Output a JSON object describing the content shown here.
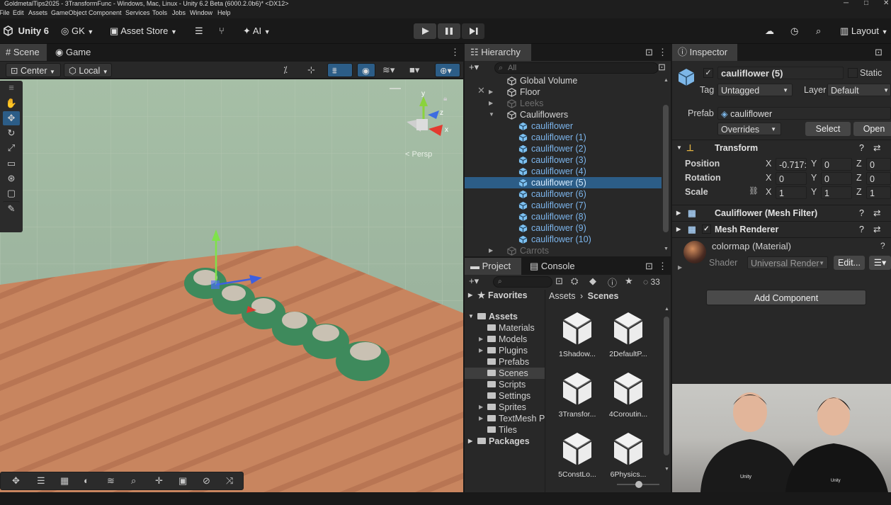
{
  "window": {
    "title": "GoldmetalTips2025 - 3TransformFunc - Windows, Mac, Linux - Unity 6.2 Beta (6000.2.0b6)* <DX12>",
    "controls": [
      "─",
      "□",
      "✕"
    ]
  },
  "menu": [
    "File",
    "Edit",
    "Assets",
    "GameObject",
    "Component",
    "Services",
    "Tools",
    "Jobs",
    "Window",
    "Help"
  ],
  "toolbar": {
    "unity_label": "Unity 6",
    "account_label": "GK",
    "asset_store_label": "Asset Store",
    "ai_label": "AI",
    "layout_label": "Layout"
  },
  "scene_panel": {
    "tabs": [
      "Scene",
      "Game"
    ],
    "pivot_mode": "Center",
    "pivot_space": "Local",
    "persp_label": "< Persp",
    "gizmo_axes": {
      "y": "y",
      "z": "z",
      "x": "x"
    }
  },
  "hierarchy": {
    "title": "Hierarchy",
    "search_placeholder": "All",
    "items": [
      {
        "label": "Global Volume",
        "indent": 0,
        "state": "normal",
        "foldout": "none"
      },
      {
        "label": "Floor",
        "indent": 0,
        "state": "normal",
        "foldout": "closed"
      },
      {
        "label": "Leeks",
        "indent": 0,
        "state": "disabled",
        "foldout": "closed"
      },
      {
        "label": "Cauliflowers",
        "indent": 0,
        "state": "normal",
        "foldout": "open"
      },
      {
        "label": "cauliflower",
        "indent": 1,
        "state": "prefab",
        "foldout": "none"
      },
      {
        "label": "cauliflower (1)",
        "indent": 1,
        "state": "prefab",
        "foldout": "none"
      },
      {
        "label": "cauliflower (2)",
        "indent": 1,
        "state": "prefab",
        "foldout": "none"
      },
      {
        "label": "cauliflower (3)",
        "indent": 1,
        "state": "prefab",
        "foldout": "none"
      },
      {
        "label": "cauliflower (4)",
        "indent": 1,
        "state": "prefab",
        "foldout": "none"
      },
      {
        "label": "cauliflower (5)",
        "indent": 1,
        "state": "selected",
        "foldout": "none"
      },
      {
        "label": "cauliflower (6)",
        "indent": 1,
        "state": "prefab",
        "foldout": "none"
      },
      {
        "label": "cauliflower (7)",
        "indent": 1,
        "state": "prefab",
        "foldout": "none"
      },
      {
        "label": "cauliflower (8)",
        "indent": 1,
        "state": "prefab",
        "foldout": "none"
      },
      {
        "label": "cauliflower (9)",
        "indent": 1,
        "state": "prefab",
        "foldout": "none"
      },
      {
        "label": "cauliflower (10)",
        "indent": 1,
        "state": "prefab",
        "foldout": "none"
      },
      {
        "label": "Carrots",
        "indent": 0,
        "state": "disabled",
        "foldout": "closed"
      }
    ]
  },
  "project": {
    "tabs": [
      "Project",
      "Console"
    ],
    "hidden_count": "33",
    "favorites_label": "Favorites",
    "assets_label": "Assets",
    "folders": [
      {
        "label": "Materials",
        "foldout": "none"
      },
      {
        "label": "Models",
        "foldout": "closed"
      },
      {
        "label": "Plugins",
        "foldout": "closed"
      },
      {
        "label": "Prefabs",
        "foldout": "none"
      },
      {
        "label": "Scenes",
        "foldout": "none",
        "selected": true
      },
      {
        "label": "Scripts",
        "foldout": "none"
      },
      {
        "label": "Settings",
        "foldout": "none"
      },
      {
        "label": "Sprites",
        "foldout": "closed"
      },
      {
        "label": "TextMesh P",
        "foldout": "closed"
      },
      {
        "label": "Tiles",
        "foldout": "none"
      }
    ],
    "packages_label": "Packages",
    "breadcrumb": [
      "Assets",
      "Scenes"
    ],
    "assets": [
      "1Shadow...",
      "2DefaultP...",
      "3Transfor...",
      "4Coroutin...",
      "5ConstLo...",
      "6Physics..."
    ]
  },
  "inspector": {
    "title": "Inspector",
    "object_name": "cauliflower (5)",
    "static_label": "Static",
    "tag_label": "Tag",
    "tag_value": "Untagged",
    "layer_label": "Layer",
    "layer_value": "Default",
    "prefab_label": "Prefab",
    "prefab_value": "cauliflower",
    "overrides_label": "Overrides",
    "select_label": "Select",
    "open_label": "Open",
    "transform": {
      "title": "Transform",
      "position_label": "Position",
      "rotation_label": "Rotation",
      "scale_label": "Scale",
      "axis_labels": [
        "X",
        "Y",
        "Z"
      ],
      "position": [
        "-0.717:",
        "0",
        "0"
      ],
      "rotation": [
        "0",
        "0",
        "0"
      ],
      "scale": [
        "1",
        "1",
        "1"
      ]
    },
    "mesh_filter_title": "Cauliflower (Mesh Filter)",
    "mesh_renderer_title": "Mesh Renderer",
    "material_name": "colormap (Material)",
    "shader_label": "Shader",
    "shader_value": "Universal Render",
    "edit_label": "Edit...",
    "add_component_label": "Add Component"
  },
  "webcam": {
    "shirt_logo_left": "Unity",
    "shirt_logo_right": "Unity"
  },
  "colors": {
    "accent_selection": "#2c5d87",
    "prefab_text": "#7cb5ec",
    "floor": "#c78560",
    "sky": "#9db59f"
  }
}
